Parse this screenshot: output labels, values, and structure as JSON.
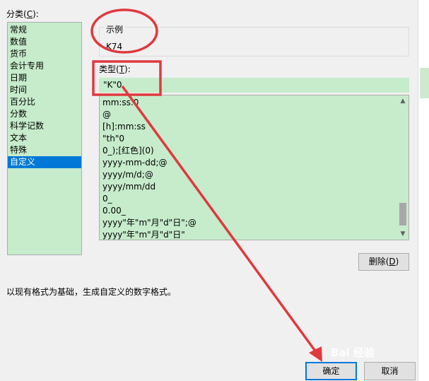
{
  "dialog": {
    "category_label_pre": "分类(",
    "category_label_key": "C",
    "category_label_post": "):",
    "categories": [
      "常规",
      "数值",
      "货币",
      "会计专用",
      "日期",
      "时间",
      "百分比",
      "分数",
      "科学记数",
      "文本",
      "特殊",
      "自定义"
    ],
    "selected_category": "自定义",
    "sample_label": "示例",
    "sample_value": "K74",
    "type_label_pre": "类型(",
    "type_label_key": "T",
    "type_label_post": "):",
    "type_input_value": "\"K\"0",
    "formats": [
      "mm:ss.0",
      "@",
      "[h]:mm:ss",
      "\"th\"0",
      "0_);[红色](0)",
      "yyyy-mm-dd;@",
      "yyyy/m/d;@",
      "yyyy/mm/dd",
      "0_",
      "0.00_",
      "yyyy\"年\"m\"月\"d\"日\";@",
      "yyyy\"年\"m\"月\"d\"日\""
    ],
    "delete_button_pre": "删除(",
    "delete_button_key": "D",
    "delete_button_post": ")",
    "description": "以现有格式为基础，生成自定义的数字格式。",
    "ok_label": "确定",
    "cancel_label": "取消",
    "watermark_text": "Bai 经验"
  },
  "colors": {
    "annotation": "#e0393e",
    "list_background": "#c6eccb",
    "selection": "#0078d7"
  }
}
